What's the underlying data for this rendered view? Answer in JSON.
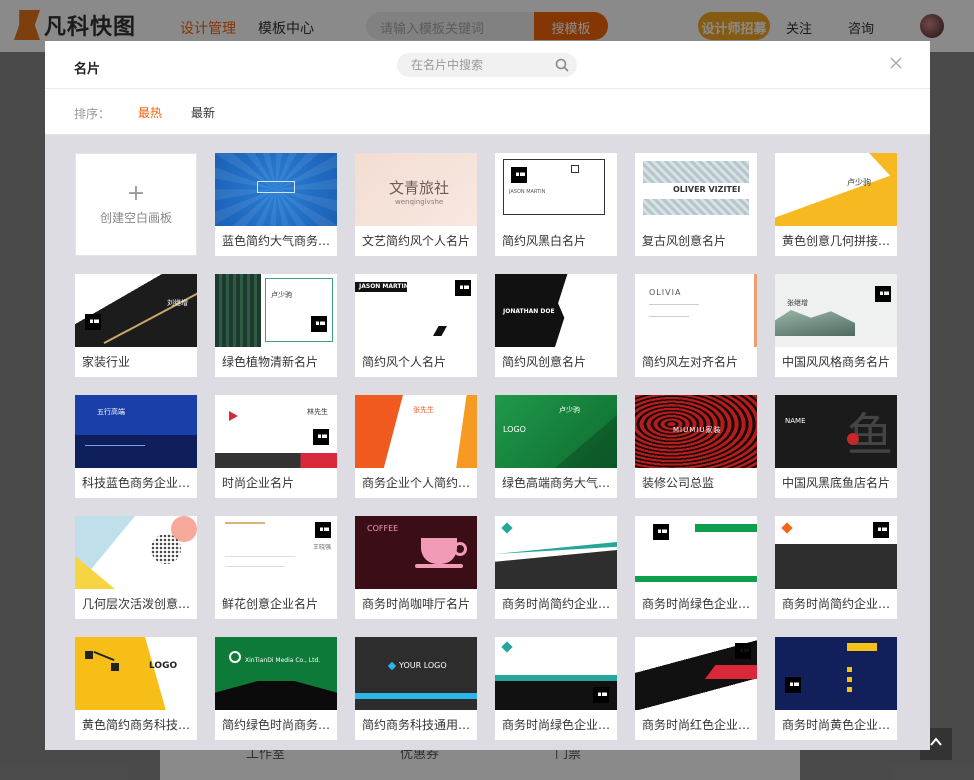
{
  "header": {
    "logo_text": "凡科快图",
    "nav": [
      "设计管理",
      "模板中心"
    ],
    "search_placeholder": "请输入模板关键词",
    "search_button": "搜模板",
    "designer_button": "设计师招募",
    "follow": "关注",
    "consult": "咨询"
  },
  "bottom_bar": [
    "工作室",
    "优惠券",
    "门票"
  ],
  "modal": {
    "title": "名片",
    "search_placeholder": "在名片中搜索",
    "sort_label": "排序：",
    "sort_options": [
      "最热",
      "最新"
    ],
    "sort_active": "最热",
    "blank_card": {
      "plus": "+",
      "label": "创建空白画板"
    },
    "templates": [
      {
        "title": "蓝色简约大气商务名片"
      },
      {
        "title": "文艺简约风个人名片"
      },
      {
        "title": "简约风黑白名片"
      },
      {
        "title": "复古风创意名片"
      },
      {
        "title": "黄色创意几何拼接名片"
      },
      {
        "title": "家装行业"
      },
      {
        "title": "绿色植物清新名片"
      },
      {
        "title": "简约风个人名片"
      },
      {
        "title": "简约风创意名片"
      },
      {
        "title": "简约风左对齐名片"
      },
      {
        "title": "中国风风格商务名片"
      },
      {
        "title": "科技蓝色商务企业名片"
      },
      {
        "title": "时尚企业名片"
      },
      {
        "title": "商务企业个人简约名片"
      },
      {
        "title": "绿色高端商务大气名片"
      },
      {
        "title": "装修公司总监"
      },
      {
        "title": "中国风黑底鱼店名片"
      },
      {
        "title": "几何层次活泼创意名片"
      },
      {
        "title": "鲜花创意企业名片"
      },
      {
        "title": "商务时尚咖啡厅名片"
      },
      {
        "title": "商务时尚简约企业名片"
      },
      {
        "title": "商务时尚绿色企业名片"
      },
      {
        "title": "商务时尚简约企业名片"
      },
      {
        "title": "黄色简约商务科技名片"
      },
      {
        "title": "简约绿色时尚商务名片"
      },
      {
        "title": "简约商务科技通用名片"
      },
      {
        "title": "商务时尚绿色企业名片"
      },
      {
        "title": "商务时尚红色企业名片"
      },
      {
        "title": "商务时尚黄色企业名片"
      }
    ],
    "thumb_text": {
      "t1": "文青旅社",
      "t1b": "wenqinglvshe",
      "t2": "JASON MARTIN",
      "t3": "OLIVER VIZITEI",
      "t4": "卢少驹",
      "t5": "刘继增",
      "t6": "卢少驹",
      "t7": "JASON MARTIN",
      "t8": "JONATHAN DOE",
      "t9": "OLIVIA",
      "t10": "张继增",
      "t11": "五行高端",
      "t12": "林先生",
      "t13": "张先生",
      "t14": "卢少驹",
      "t14b": "LOGO",
      "t15": "MIUMIU家装",
      "t16": "NAME",
      "t16b": "鱼",
      "t18": "王晓强",
      "t19": "COFFEE",
      "t23": "LOGO",
      "t24": "XinTianDi Media Co., Ltd.",
      "t25": "YOUR LOGO"
    }
  },
  "colors": {
    "accent": "#f5640a",
    "sort_active": "#f5640a"
  }
}
